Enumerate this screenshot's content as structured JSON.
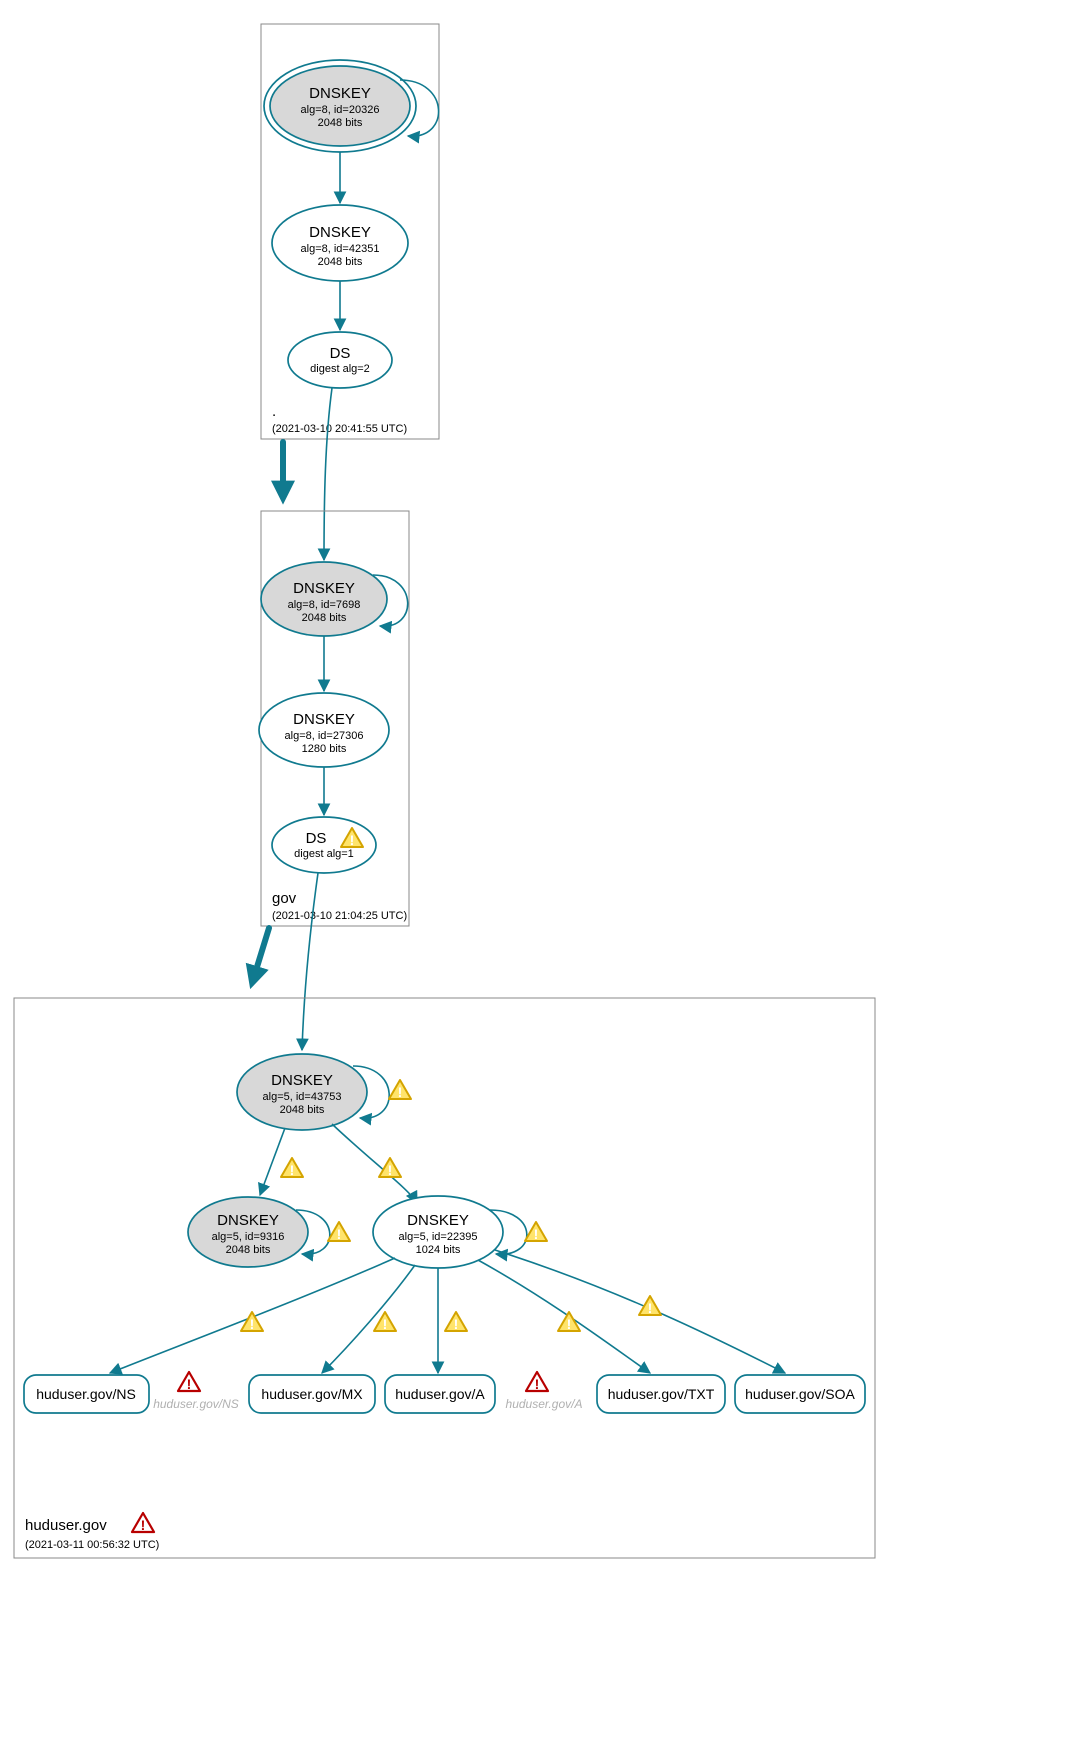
{
  "zones": {
    "root": {
      "label": ".",
      "timestamp": "(2021-03-10 20:41:55 UTC)",
      "dnskey_ksk": {
        "title": "DNSKEY",
        "sub1": "alg=8, id=20326",
        "sub2": "2048 bits"
      },
      "dnskey_zsk": {
        "title": "DNSKEY",
        "sub1": "alg=8, id=42351",
        "sub2": "2048 bits"
      },
      "ds": {
        "title": "DS",
        "sub1": "digest alg=2"
      }
    },
    "gov": {
      "label": "gov",
      "timestamp": "(2021-03-10 21:04:25 UTC)",
      "dnskey_ksk": {
        "title": "DNSKEY",
        "sub1": "alg=8, id=7698",
        "sub2": "2048 bits"
      },
      "dnskey_zsk": {
        "title": "DNSKEY",
        "sub1": "alg=8, id=27306",
        "sub2": "1280 bits"
      },
      "ds": {
        "title": "DS",
        "sub1": "digest alg=1"
      }
    },
    "huduser": {
      "label": "huduser.gov",
      "timestamp": "(2021-03-11 00:56:32 UTC)",
      "dnskey_ksk": {
        "title": "DNSKEY",
        "sub1": "alg=5, id=43753",
        "sub2": "2048 bits"
      },
      "dnskey_a": {
        "title": "DNSKEY",
        "sub1": "alg=5, id=9316",
        "sub2": "2048 bits"
      },
      "dnskey_b": {
        "title": "DNSKEY",
        "sub1": "alg=5, id=22395",
        "sub2": "1024 bits"
      },
      "rr_ns": "huduser.gov/NS",
      "rr_mx": "huduser.gov/MX",
      "rr_a": "huduser.gov/A",
      "rr_txt": "huduser.gov/TXT",
      "rr_soa": "huduser.gov/SOA",
      "ghost_ns": "huduser.gov/NS",
      "ghost_a": "huduser.gov/A"
    }
  }
}
